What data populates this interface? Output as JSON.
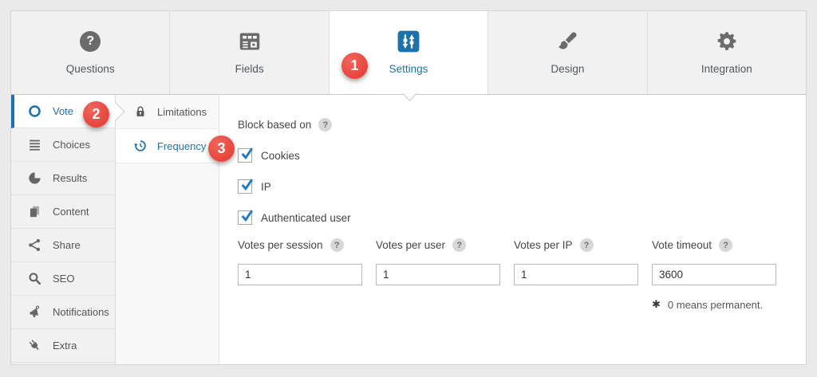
{
  "colors": {
    "accent": "#1d72ad",
    "badge": "#e8453c",
    "active_bg": "#ffffff",
    "strip_bg": "#f1f1f1"
  },
  "annotations": {
    "steps": [
      "1",
      "2",
      "3"
    ]
  },
  "tabs": [
    {
      "label": "Questions",
      "icon": "question-circle-icon",
      "glyph": "?",
      "active": false
    },
    {
      "label": "Fields",
      "icon": "form-fields-icon",
      "active": false
    },
    {
      "label": "Settings",
      "icon": "sliders-icon",
      "active": true
    },
    {
      "label": "Design",
      "icon": "paintbrush-icon",
      "active": false
    },
    {
      "label": "Integration",
      "icon": "gear-icon",
      "active": false
    }
  ],
  "sidebar": {
    "items": [
      {
        "label": "Vote",
        "icon": "circle-outline-icon",
        "active": true
      },
      {
        "label": "Choices",
        "icon": "list-lines-icon",
        "active": false
      },
      {
        "label": "Results",
        "icon": "pie-chart-icon",
        "active": false
      },
      {
        "label": "Content",
        "icon": "pages-icon",
        "active": false
      },
      {
        "label": "Share",
        "icon": "share-nodes-icon",
        "active": false
      },
      {
        "label": "SEO",
        "icon": "magnifier-icon",
        "active": false
      },
      {
        "label": "Notifications",
        "icon": "megaphone-icon",
        "active": false
      },
      {
        "label": "Extra",
        "icon": "plug-icon",
        "active": false
      }
    ]
  },
  "submenu": {
    "items": [
      {
        "label": "Limitations",
        "icon": "lock-icon",
        "active": false
      },
      {
        "label": "Frequency",
        "icon": "history-clock-icon",
        "active": true
      }
    ]
  },
  "content": {
    "section_label": "Block based on",
    "help_symbol": "?",
    "checkboxes": [
      {
        "label": "Cookies",
        "checked": true
      },
      {
        "label": "IP",
        "checked": true
      },
      {
        "label": "Authenticated user",
        "checked": true
      }
    ],
    "fields": [
      {
        "label": "Votes per session",
        "value": "1"
      },
      {
        "label": "Votes per user",
        "value": "1"
      },
      {
        "label": "Votes per IP",
        "value": "1"
      },
      {
        "label": "Vote timeout",
        "value": "3600"
      }
    ],
    "note": {
      "marker": "✱",
      "text": "0 means permanent."
    }
  }
}
